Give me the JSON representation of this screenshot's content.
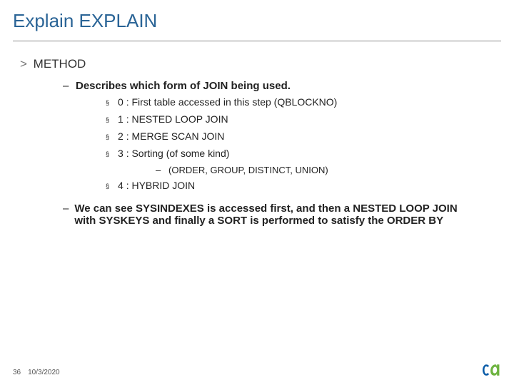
{
  "header": {
    "title": "Explain EXPLAIN"
  },
  "section": {
    "angle": ">",
    "name": "METHOD"
  },
  "desc_line": {
    "marker": "–",
    "text": "Describes which form of JOIN being used."
  },
  "items": [
    {
      "marker": "§",
      "text": "0 : First table accessed in this step (QBLOCKNO)"
    },
    {
      "marker": "§",
      "text": "1 : NESTED LOOP JOIN"
    },
    {
      "marker": "§",
      "text": "2 : MERGE SCAN JOIN"
    },
    {
      "marker": "§",
      "text": "3 : Sorting (of some kind)"
    }
  ],
  "subnote": {
    "marker": "–",
    "text": "(ORDER, GROUP, DISTINCT, UNION)"
  },
  "item4": {
    "marker": "§",
    "text": "4 : HYBRID JOIN"
  },
  "summary": {
    "marker": "–",
    "text": "We can see SYSINDEXES is accessed first, and then a NESTED LOOP JOIN with SYSKEYS and finally a SORT is performed to satisfy the ORDER BY"
  },
  "footer": {
    "page": "36",
    "date": "10/3/2020"
  }
}
